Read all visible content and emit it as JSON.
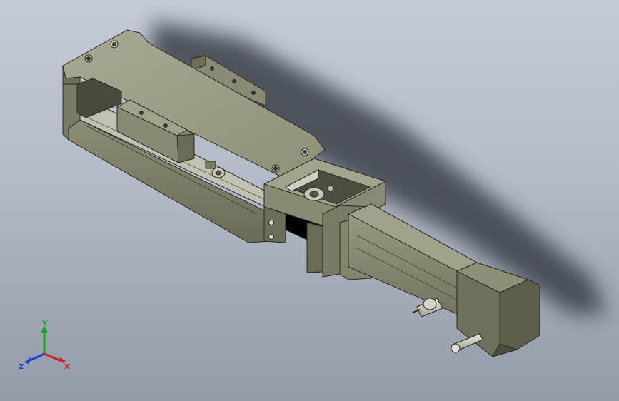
{
  "viewport": {
    "background_top": "#c4cad6",
    "background_bottom": "#949ba9"
  },
  "model": {
    "body_color": "#8d8d76",
    "body_light": "#a8a891",
    "body_dark": "#5e5e4c",
    "edge_color": "#2a2a22",
    "rail_color": "#c2c2b4",
    "shaft_color": "#d6d6cc"
  },
  "triad": {
    "x_label": "X",
    "y_label": "Y",
    "z_label": "Z",
    "x_color": "#d11f1f",
    "y_color": "#1ea51e",
    "z_color": "#1f3fd1"
  }
}
